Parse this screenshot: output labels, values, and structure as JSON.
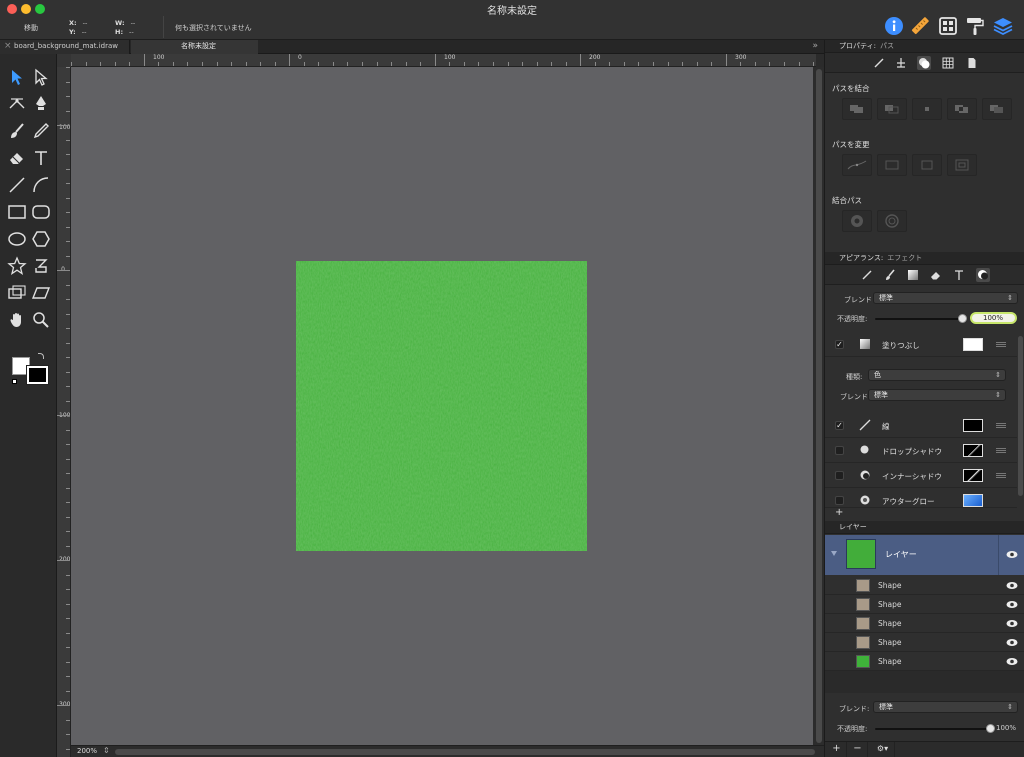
{
  "window": {
    "title": "名称未設定",
    "tool_name": "移動",
    "coords": {
      "x_label": "X:",
      "x_value": "--",
      "y_label": "Y:",
      "y_value": "--",
      "w_label": "W:",
      "w_value": "--",
      "h_label": "H:",
      "h_value": "--"
    },
    "selection_status": "何も選択されていません",
    "toolbar_icons": [
      "info-icon",
      "ruler-icon",
      "grid-icon",
      "paint-roller-icon",
      "layers-icon"
    ]
  },
  "tabs": [
    {
      "label": "board_background_mat.idraw"
    },
    {
      "label": "名称未設定"
    }
  ],
  "tab_overflow": "»",
  "rulers": {
    "top": [
      "100",
      "0",
      "100",
      "200",
      "300"
    ],
    "left": [
      "100",
      "0",
      "100",
      "200",
      "300"
    ]
  },
  "artboard": {
    "fill": "#42ad3a"
  },
  "status": {
    "zoom": "200%",
    "zoom_stepper": "⇕"
  },
  "inspector": {
    "properties": {
      "title": "プロパティ:",
      "subtitle": "パス"
    },
    "combine_paths": {
      "label": "パスを結合"
    },
    "modify_paths": {
      "label": "パスを変更"
    },
    "compound_paths": {
      "label": "結合パス"
    },
    "appearance": {
      "title": "アピアランス:",
      "subtitle": "エフェクト"
    },
    "blend_label": "ブレンド",
    "blend_value": "標準",
    "opacity_label": "不透明度:",
    "opacity_value": "100%",
    "opacity_fraction": 1.0,
    "fill": {
      "checked": true,
      "label": "塗りつぶし",
      "color": "#ffffff"
    },
    "type_label": "種類:",
    "type_value": "色",
    "fill_blend_label": "ブレンド",
    "fill_blend_value": "標準",
    "effects": [
      {
        "checked": true,
        "label": "線",
        "color": "#000000",
        "icon": "line-icon"
      },
      {
        "checked": false,
        "label": "ドロップシャドウ",
        "color": "#000000",
        "icon": "drop-shadow-icon"
      },
      {
        "checked": false,
        "label": "インナーシャドウ",
        "color": "#000000",
        "icon": "inner-shadow-icon"
      },
      {
        "checked": false,
        "label": "アウターグロー",
        "color": "#2b7bff",
        "icon": "outer-glow-icon"
      }
    ],
    "add_effect": "+"
  },
  "layers": {
    "title": "レイヤー",
    "main": {
      "name": "レイヤー",
      "color": "#42ad3a"
    },
    "items": [
      {
        "name": "Shape",
        "color": "#a89a88"
      },
      {
        "name": "Shape",
        "color": "#a89a88"
      },
      {
        "name": "Shape",
        "color": "#a89a88"
      },
      {
        "name": "Shape",
        "color": "#a89a88"
      },
      {
        "name": "Shape",
        "color": "#3fb23a"
      }
    ],
    "blend_label": "ブレンド:",
    "blend_value": "標準",
    "opacity_label": "不透明度:",
    "opacity_value": "100%",
    "opacity_fraction": 1.0,
    "buttons": {
      "add": "+",
      "remove": "−",
      "gear": "⚙▾"
    }
  },
  "colors": {
    "accent": "#4a6fb5",
    "selected_layer_bg": "#4b5d84",
    "tool_active": "#3d9bff"
  }
}
